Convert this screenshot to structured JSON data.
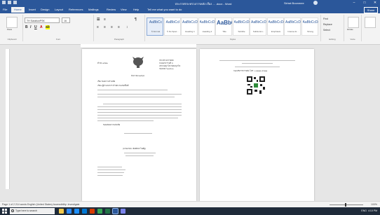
{
  "window": {
    "title": "ประกาศกระทรวงการคลัง เรื่อง ... .docx - Word",
    "user": "Sirirat Boonmee"
  },
  "tabs": [
    "File",
    "Home",
    "Insert",
    "Design",
    "Layout",
    "References",
    "Mailings",
    "Review",
    "View",
    "Help",
    "Tell me what you want to do"
  ],
  "share_label": "Share",
  "ribbon": {
    "clipboard_label": "Clipboard",
    "paste_label": "Paste",
    "font_name": "TH SarabunPSK",
    "font_size": "16",
    "font_label": "Font",
    "paragraph_label": "Paragraph",
    "styles_label": "Styles",
    "styles": [
      {
        "preview": "AaBbCc",
        "name": "¶ Normal"
      },
      {
        "preview": "AaBbCcI",
        "name": "¶ No Spac..."
      },
      {
        "preview": "AaBbCcDd",
        "name": "Heading 1"
      },
      {
        "preview": "AaBbCcD",
        "name": "Heading 2"
      },
      {
        "preview": "AaBbCcI",
        "name": "Title"
      },
      {
        "preview": "AaBbCcDd",
        "name": "Subtitle"
      },
      {
        "preview": "AaBbCcDd",
        "name": "Subtle Em..."
      },
      {
        "preview": "AaBbCcDd",
        "name": "Emphasis"
      },
      {
        "preview": "AaBbCcDd",
        "name": "Intense E..."
      },
      {
        "preview": "AaBbCcDd",
        "name": "Strong"
      }
    ],
    "editing": [
      "Find",
      "Replace",
      "Select"
    ],
    "editing_label": "Editing",
    "dictate_label": "Dictate",
    "voice_label": "Voice"
  },
  "document": {
    "page1_ref": "ที่ กค ๐๔๒๒",
    "page1_address": [
      "กระทรวงการคลัง",
      "ถนนพระรามที่ ๖",
      "แขวงพญาไท เขตพญาไท",
      "กรุงเทพฯ ๑๐๔๐๐"
    ],
    "page1_date": "ธันวาคม ๒๕๖๔",
    "page1_subject": "เรื่อง  ขอความร่วมมือ",
    "page1_to": "เรียน  ผู้อำนวยการ สำนักงานเขตพื้นที่",
    "page1_closing": "ขอแสดงความนับถือ",
    "page1_sign": "(นายอาคม เติมพิทยาไพสิฐ)",
    "page2_note": "กองบริหารการคลัง โทร. ๐ ๒๒๗๓ ๙๐๒๑"
  },
  "status": {
    "left": "Page 1 of 2   214 words   English (United States)   Accessibility: Investigate",
    "zoom": "100%"
  },
  "taskbar": {
    "search_placeholder": "Type here to search",
    "time": "4:10 PM",
    "lang": "ENG"
  }
}
